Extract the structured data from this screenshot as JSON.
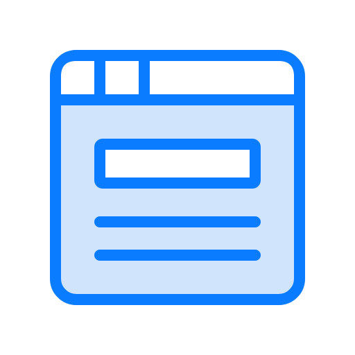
{
  "icon": {
    "name": "browser-window-icon",
    "colors": {
      "stroke": "#0A7CFF",
      "fill": "#D0E4FB",
      "background": "#FFFFFF"
    }
  }
}
